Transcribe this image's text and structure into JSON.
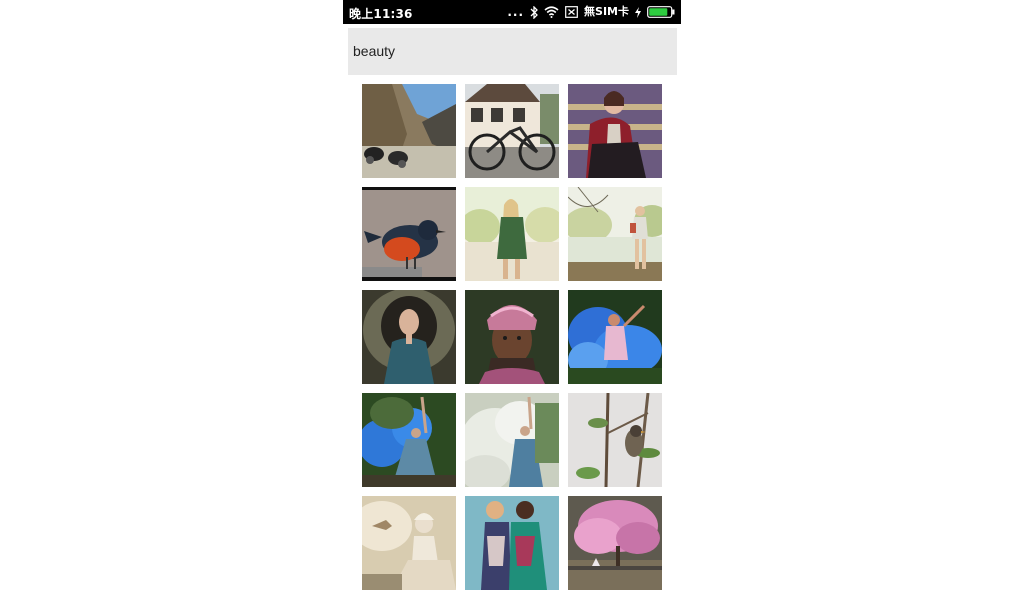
{
  "status_bar": {
    "time": "晚上11:36",
    "dots": "...",
    "sim_label": "無SIM卡",
    "icons": [
      "bluetooth-icon",
      "wifi-icon",
      "no-sim-icon",
      "charging-icon",
      "battery-icon"
    ],
    "battery_level": 0.85,
    "battery_color": "#2ecc40"
  },
  "search": {
    "query": "beauty"
  },
  "results": [
    {
      "label": "motorcycles-mountain-road"
    },
    {
      "label": "bicycle-timber-house"
    },
    {
      "label": "woman-red-cardigan-stairs"
    },
    {
      "label": "red-breasted-bird"
    },
    {
      "label": "woman-green-dress-lake"
    },
    {
      "label": "woman-lakeside-bright"
    },
    {
      "label": "woman-teal-dress-forest"
    },
    {
      "label": "woman-pink-headwrap"
    },
    {
      "label": "woman-blue-smoke"
    },
    {
      "label": "woman-blue-smoke-raised-arm"
    },
    {
      "label": "woman-white-smoke"
    },
    {
      "label": "bird-on-branch"
    },
    {
      "label": "woman-white-gown-sepia"
    },
    {
      "label": "two-women-fashion"
    },
    {
      "label": "pink-blossom-tree"
    }
  ]
}
